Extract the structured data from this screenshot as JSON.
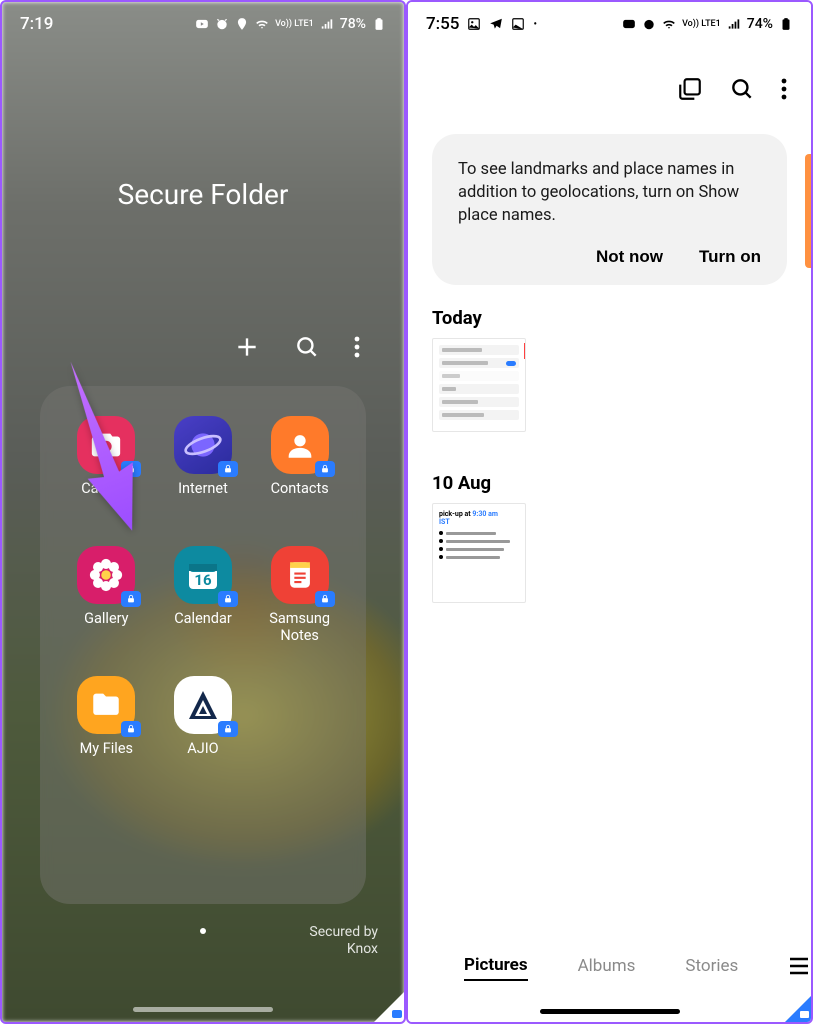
{
  "left": {
    "status": {
      "time": "7:19",
      "battery": "78%",
      "net": "Vo)) LTE1"
    },
    "title": "Secure Folder",
    "knox_line1": "Secured by",
    "knox_line2": "Knox",
    "apps": [
      {
        "label": "Camera",
        "bg": "#e5305f",
        "glyph": "camera"
      },
      {
        "label": "Internet",
        "bg": "#2e3fa8",
        "glyph": "planet"
      },
      {
        "label": "Contacts",
        "bg": "#ff7a2a",
        "glyph": "contact"
      },
      {
        "label": "Gallery",
        "bg": "#d81e6a",
        "glyph": "flower"
      },
      {
        "label": "Calendar",
        "bg": "#0d8aa0",
        "glyph": "calendar",
        "cal_day": "16"
      },
      {
        "label": "Samsung Notes",
        "bg": "#ef4136",
        "glyph": "notes"
      },
      {
        "label": "My Files",
        "bg": "#ffa51f",
        "glyph": "folder"
      },
      {
        "label": "AJIO",
        "bg": "#ffffff",
        "glyph": "ajio"
      }
    ]
  },
  "right": {
    "status": {
      "time": "7:55",
      "battery": "74%",
      "net": "Vo)) LTE1"
    },
    "notice": {
      "text": "To see landmarks and place names in addition to geolocations, turn on Show place names.",
      "not_now": "Not now",
      "turn_on": "Turn on"
    },
    "sections": {
      "today": "Today",
      "aug": "10 Aug"
    },
    "thumb2": {
      "prefix": "pick-up at ",
      "time": "9:30 am",
      "tz": "IST"
    },
    "tabs": {
      "pictures": "Pictures",
      "albums": "Albums",
      "stories": "Stories"
    }
  }
}
